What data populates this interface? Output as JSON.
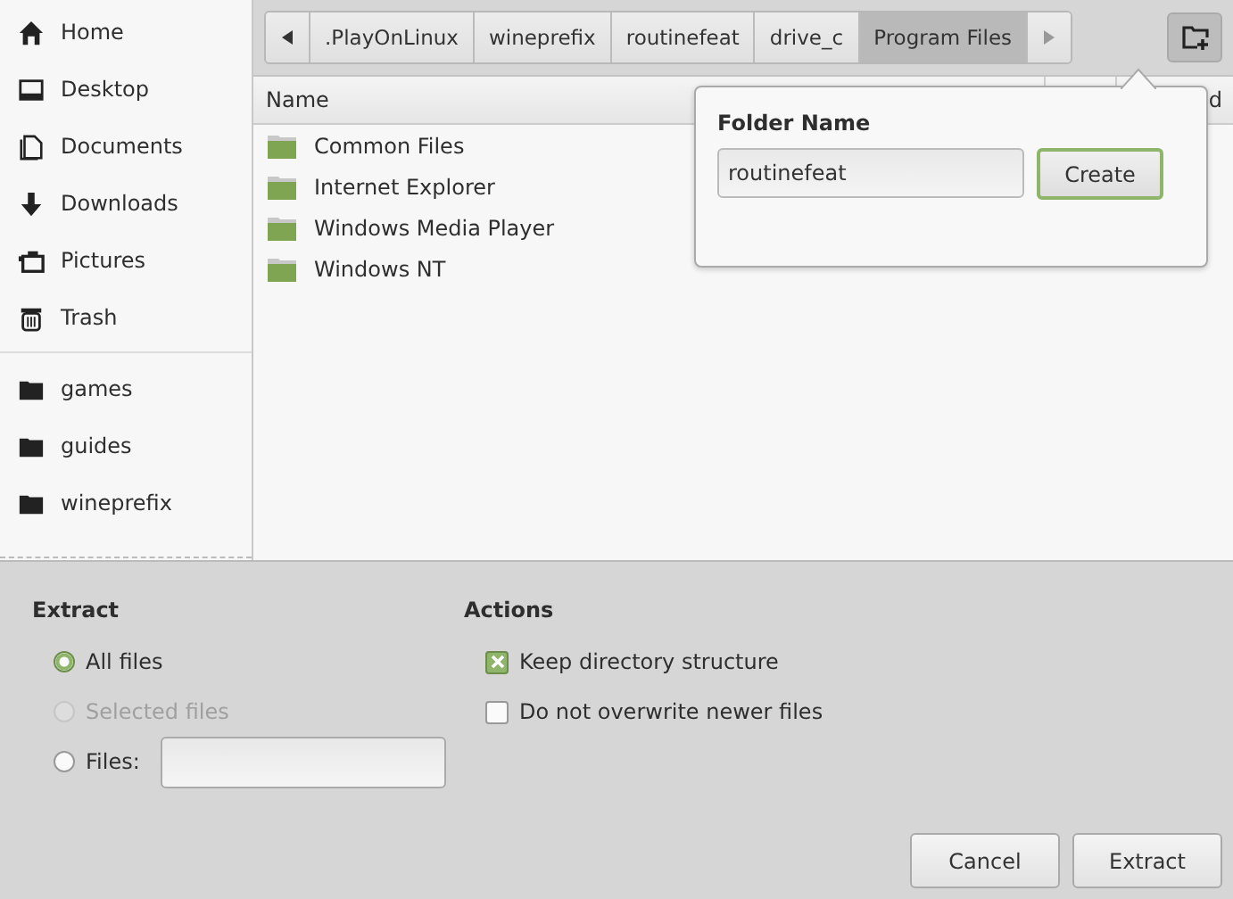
{
  "sidebar": {
    "places": [
      {
        "label": "Home",
        "kind": "home"
      },
      {
        "label": "Desktop",
        "kind": "desktop"
      },
      {
        "label": "Documents",
        "kind": "documents"
      },
      {
        "label": "Downloads",
        "kind": "downloads"
      },
      {
        "label": "Pictures",
        "kind": "pictures"
      },
      {
        "label": "Trash",
        "kind": "trash"
      }
    ],
    "bookmarks": [
      {
        "label": "games",
        "kind": "folder"
      },
      {
        "label": "guides",
        "kind": "folder"
      },
      {
        "label": "wineprefix",
        "kind": "folder"
      }
    ]
  },
  "path_bar": [
    {
      "label": ".PlayOnLinux",
      "selected": false
    },
    {
      "label": "wineprefix",
      "selected": false
    },
    {
      "label": "routinefeat",
      "selected": false
    },
    {
      "label": "drive_c",
      "selected": false
    },
    {
      "label": "Program Files",
      "selected": true
    }
  ],
  "file_list": {
    "columns": [
      {
        "label": "Name"
      },
      {
        "label": "d"
      }
    ],
    "rows": [
      {
        "name": "Common Files"
      },
      {
        "name": "Internet Explorer"
      },
      {
        "name": "Windows Media Player"
      },
      {
        "name": "Windows NT"
      }
    ]
  },
  "new_folder_popover": {
    "title": "Folder Name",
    "value": "routinefeat",
    "button": "Create"
  },
  "extract": {
    "title": "Extract",
    "options": [
      {
        "label": "All files",
        "selected": true,
        "disabled": false
      },
      {
        "label": "Selected files",
        "selected": false,
        "disabled": true
      },
      {
        "label": "Files:",
        "selected": false,
        "disabled": false,
        "field": true
      }
    ]
  },
  "actions": {
    "title": "Actions",
    "options": [
      {
        "label": "Keep directory structure",
        "checked": true
      },
      {
        "label": "Do not overwrite newer files",
        "checked": false
      }
    ]
  },
  "buttons": [
    "Cancel",
    "Extract"
  ]
}
